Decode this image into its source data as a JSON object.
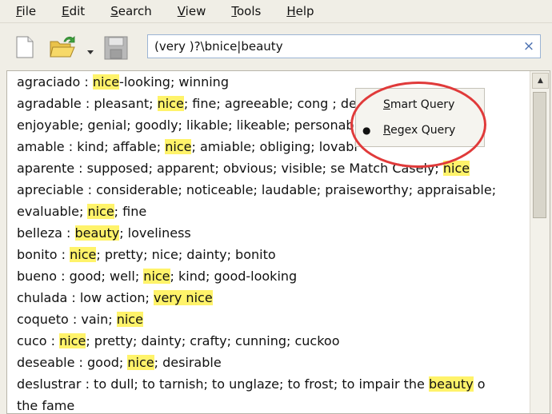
{
  "menu": {
    "items": [
      {
        "hot": "F",
        "rest": "ile"
      },
      {
        "hot": "E",
        "rest": "dit"
      },
      {
        "hot": "S",
        "rest": "earch"
      },
      {
        "hot": "V",
        "rest": "iew"
      },
      {
        "hot": "T",
        "rest": "ools"
      },
      {
        "hot": "H",
        "rest": "elp"
      }
    ]
  },
  "toolbar": {
    "icons": [
      "new-document-icon",
      "open-folder-icon",
      "chevron-down-icon",
      "save-disk-icon"
    ]
  },
  "search": {
    "value": "(very )?\\bnice|beauty",
    "clear_label": "×"
  },
  "popup": {
    "items": [
      {
        "hot": "S",
        "rest": "mart Query",
        "selected": false
      },
      {
        "hot": "R",
        "rest": "egex Query",
        "selected": true
      }
    ],
    "bullet": "●",
    "annotation_color": "#e03a3a"
  },
  "results": {
    "lines": [
      {
        "segments": [
          "agraciado       : ",
          "nice",
          "-looking; winning"
        ]
      },
      {
        "segments": [
          "agradable      : pleasant; ",
          "nice",
          "; fine; agreeable; cong                    ; delight"
        ]
      },
      {
        "segments": [
          "enjoyable; genial; goodly; likable; likeable; personab"
        ]
      },
      {
        "segments": [
          "amable : kind; affable; ",
          "nice",
          "; amiable; obliging; lovabl"
        ]
      },
      {
        "segments": [
          "aparente        : supposed; apparent; obvious; visible; se Match Casely; ",
          "nice"
        ]
      },
      {
        "segments": [
          "apreciable      : considerable; noticeable; laudable; praiseworthy; appraisable;"
        ]
      },
      {
        "segments": [
          "evaluable; ",
          "nice",
          "; fine"
        ]
      },
      {
        "segments": [
          "belleza : ",
          "beauty",
          "; loveliness"
        ]
      },
      {
        "segments": [
          "bonito : ",
          "nice",
          "; pretty; nice; dainty; bonito"
        ]
      },
      {
        "segments": [
          "bueno : good; well; ",
          "nice",
          "; kind; good-looking"
        ]
      },
      {
        "segments": [
          "chulada          : low action; ",
          "very nice"
        ]
      },
      {
        "segments": [
          "coqueto           : vain; ",
          "nice"
        ]
      },
      {
        "segments": [
          "cuco  : ",
          "nice",
          "; pretty; dainty; crafty; cunning; cuckoo"
        ]
      },
      {
        "segments": [
          "deseable          : good; ",
          "nice",
          "; desirable"
        ]
      },
      {
        "segments": [
          "deslustrar        : to dull; to tarnish; to unglaze; to frost; to impair the ",
          "beauty",
          " o"
        ]
      },
      {
        "segments": [
          "the fame"
        ]
      }
    ]
  },
  "scrollbar": {
    "up_arrow": "▲"
  },
  "colors": {
    "highlight": "#fff36a",
    "search_border": "#9bb4d4",
    "clear_icon": "#4a6fb0"
  }
}
